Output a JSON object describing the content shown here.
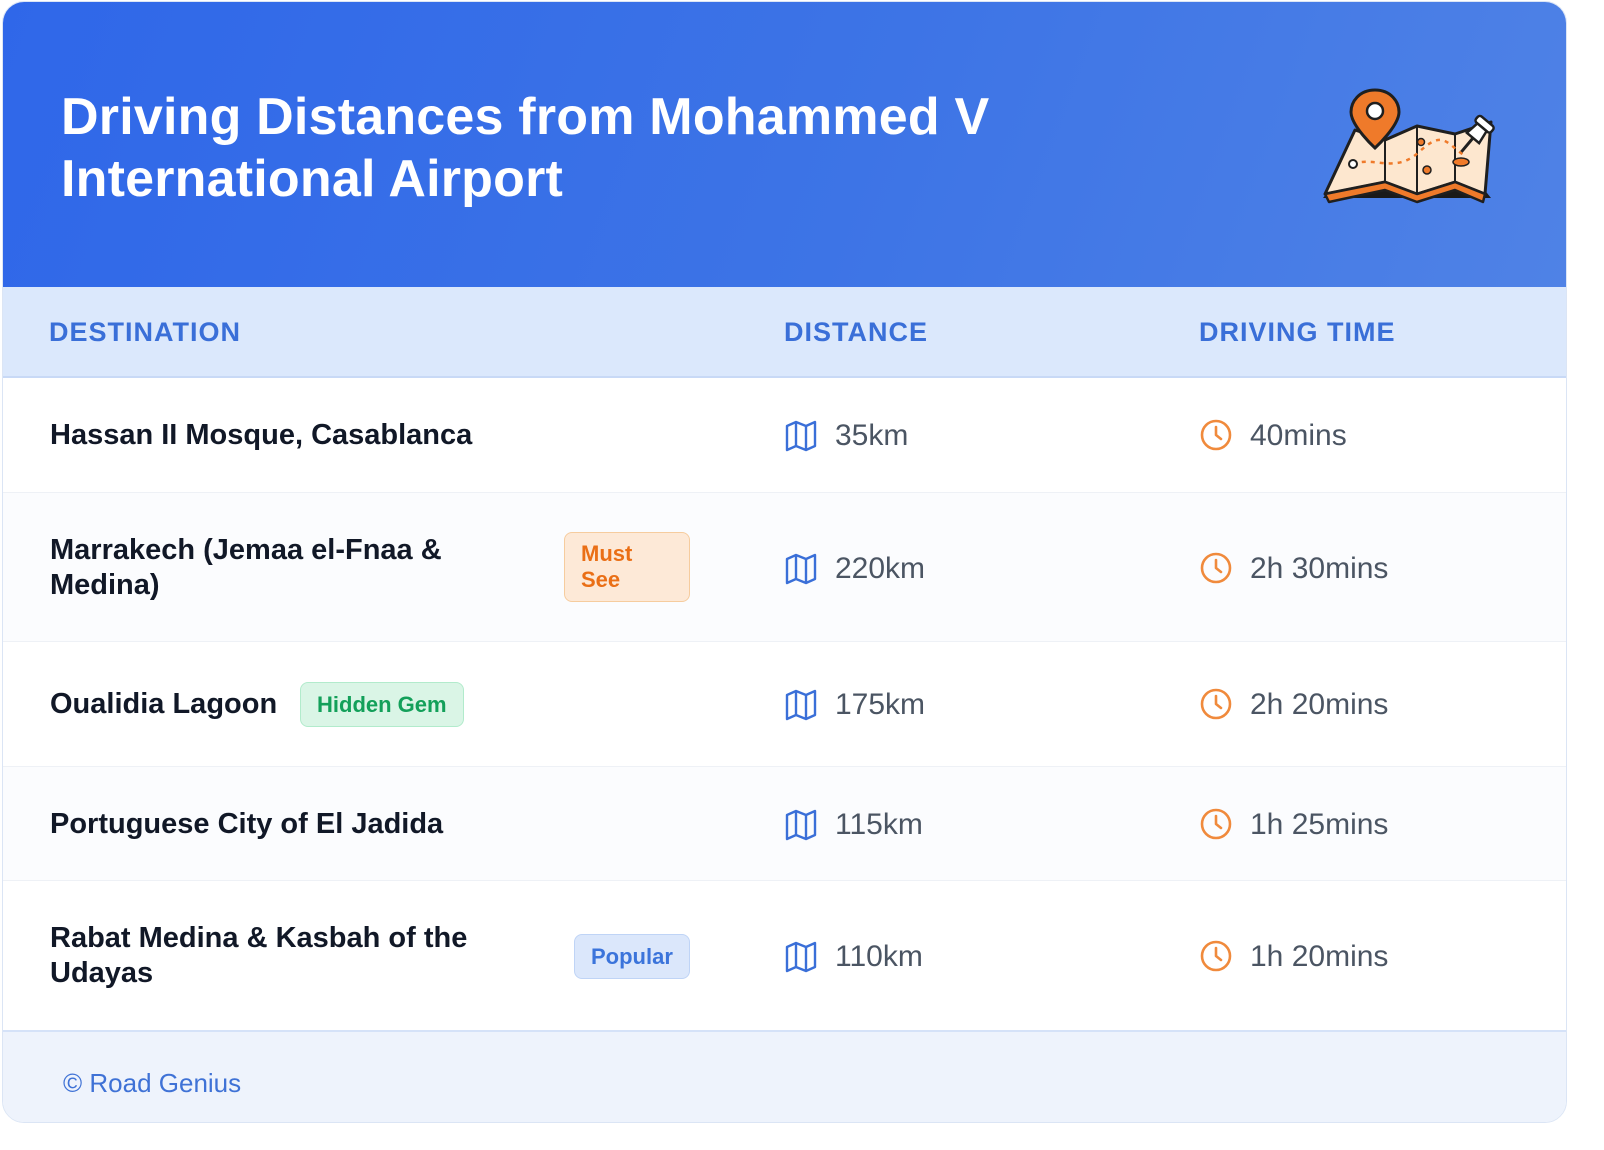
{
  "title": "Driving Distances from Mohammed V International Airport",
  "icons": {
    "header": "map-pin-illustration",
    "distance": "map-icon",
    "time": "clock-icon"
  },
  "colors": {
    "header_bg": "#3470e8",
    "table_head_bg": "#dbe8fc",
    "accent_blue": "#3a6fd8",
    "clock_orange": "#f08a3c",
    "must_see": "#ea6f16",
    "hidden_gem": "#13a05a",
    "popular": "#3b74db"
  },
  "table": {
    "headers": {
      "destination": "DESTINATION",
      "distance": "DISTANCE",
      "time": "DRIVING TIME"
    },
    "rows": [
      {
        "destination": "Hassan II Mosque, Casablanca",
        "badge": "",
        "distance": "35km",
        "time": "40mins"
      },
      {
        "destination": "Marrakech (Jemaa el-Fnaa & Medina)",
        "badge": "Must See",
        "distance": "220km",
        "time": "2h 30mins"
      },
      {
        "destination": "Oualidia Lagoon",
        "badge": "Hidden Gem",
        "distance": "175km",
        "time": "2h 20mins"
      },
      {
        "destination": "Portuguese City of El Jadida",
        "badge": "",
        "distance": "115km",
        "time": "1h 25mins"
      },
      {
        "destination": "Rabat Medina & Kasbah of the Udayas",
        "badge": "Popular",
        "distance": "110km",
        "time": "1h 20mins"
      }
    ]
  },
  "footer": {
    "credit": "© Road Genius"
  }
}
